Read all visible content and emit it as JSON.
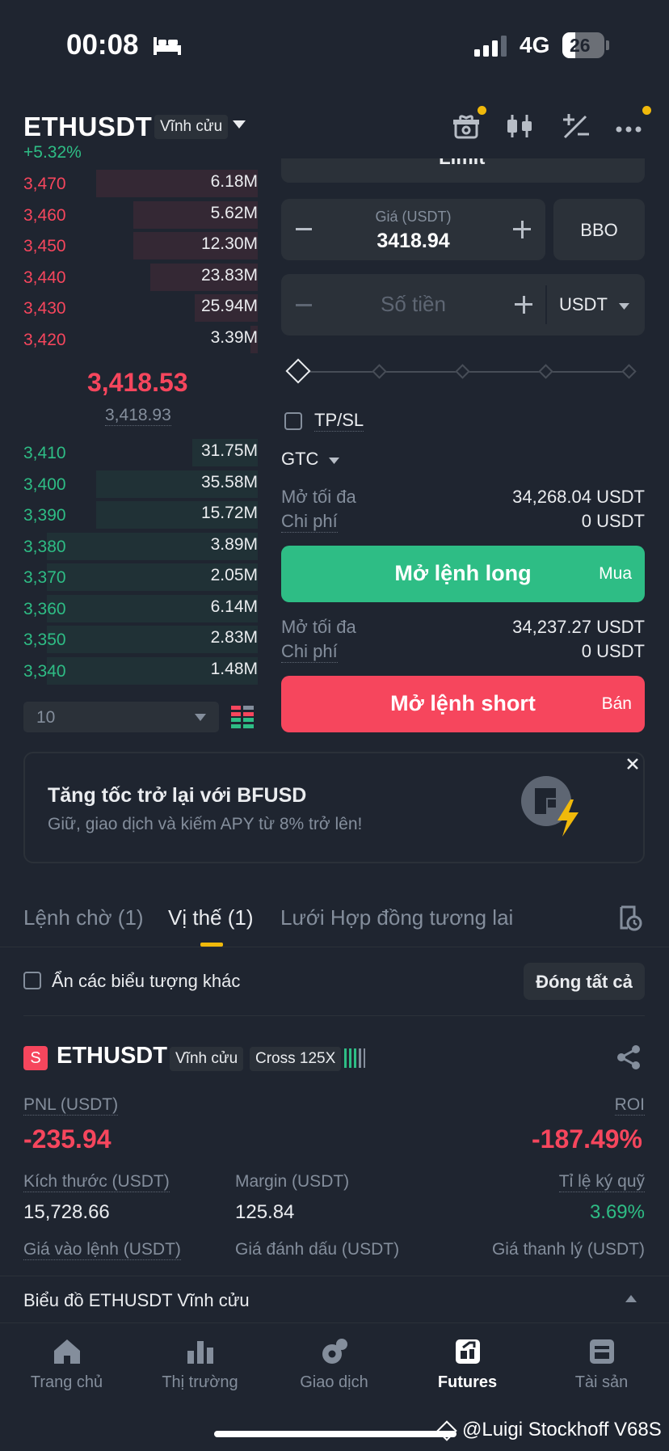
{
  "status_bar": {
    "time": "00:08",
    "network": "4G",
    "battery": "26"
  },
  "header": {
    "pair": "ETHUSDT",
    "contract_type": "Vĩnh cửu",
    "change": "+5.32%"
  },
  "colors": {
    "red": "#f6465d",
    "green": "#2ebd85",
    "accent": "#f0b90b",
    "bg": "#1f2530",
    "panel": "#2b3139"
  },
  "order_book": {
    "asks": [
      {
        "price": "3,470",
        "qty": "6.18M",
        "depth": 0.69
      },
      {
        "price": "3,460",
        "qty": "5.62M",
        "depth": 0.53
      },
      {
        "price": "3,450",
        "qty": "12.30M",
        "depth": 0.53
      },
      {
        "price": "3,440",
        "qty": "23.83M",
        "depth": 0.46
      },
      {
        "price": "3,430",
        "qty": "25.94M",
        "depth": 0.27
      },
      {
        "price": "3,420",
        "qty": "3.39M",
        "depth": 0.03
      }
    ],
    "mid_price": "3,418.53",
    "mark_price": "3,418.93",
    "bids": [
      {
        "price": "3,410",
        "qty": "31.75M",
        "depth": 0.28
      },
      {
        "price": "3,400",
        "qty": "35.58M",
        "depth": 0.69
      },
      {
        "price": "3,390",
        "qty": "15.72M",
        "depth": 0.69
      },
      {
        "price": "3,380",
        "qty": "3.89M",
        "depth": 0.9
      },
      {
        "price": "3,370",
        "qty": "2.05M",
        "depth": 0.9
      },
      {
        "price": "3,360",
        "qty": "6.14M",
        "depth": 0.9
      },
      {
        "price": "3,350",
        "qty": "2.83M",
        "depth": 0.9
      },
      {
        "price": "3,340",
        "qty": "1.48M",
        "depth": 0.9
      }
    ],
    "depth_step": "10"
  },
  "order_form": {
    "order_type": "Limit",
    "price_label": "Giá (USDT)",
    "price_value": "3418.94",
    "bbo_label": "BBO",
    "amount_placeholder": "Số tiền",
    "amount_unit": "USDT",
    "tpsl_label": "TP/SL",
    "tif": "GTC",
    "long": {
      "max_label": "Mở tối đa",
      "max_value": "34,268.04 USDT",
      "cost_label": "Chi phí",
      "cost_value": "0 USDT",
      "button": "Mở lệnh long",
      "side": "Mua"
    },
    "short": {
      "max_label": "Mở tối đa",
      "max_value": "34,237.27 USDT",
      "cost_label": "Chi phí",
      "cost_value": "0 USDT",
      "button": "Mở lệnh short",
      "side": "Bán"
    }
  },
  "banner": {
    "title": "Tăng tốc trở lại với BFUSD",
    "subtitle": "Giữ, giao dịch và kiếm APY từ 8% trở lên!"
  },
  "tabs": [
    {
      "label": "Lệnh chờ (1)"
    },
    {
      "label": "Vị thế (1)"
    },
    {
      "label": "Lưới Hợp đồng tương lai"
    }
  ],
  "positions_toolbar": {
    "hide_label": "Ẩn các biểu tượng khác",
    "close_all": "Đóng tất cả"
  },
  "position": {
    "side_badge": "S",
    "pair": "ETHUSDT",
    "contract_type": "Vĩnh cửu",
    "margin_mode": "Cross 125X",
    "pnl_label": "PNL (USDT)",
    "pnl_value": "-235.94",
    "roi_label": "ROI",
    "roi_value": "-187.49%",
    "size_label": "Kích thước (USDT)",
    "size_value": "15,728.66",
    "margin_label": "Margin (USDT)",
    "margin_value": "125.84",
    "margin_ratio_label": "Tỉ lệ ký quỹ",
    "margin_ratio_value": "3.69%",
    "entry_label": "Giá vào lệnh (USDT)",
    "mark_label": "Giá đánh dấu (USDT)",
    "liq_label": "Giá thanh lý (USDT)"
  },
  "chart_bar": {
    "label": "Biểu đồ ETHUSDT Vĩnh cửu"
  },
  "bottom_nav": [
    {
      "label": "Trang chủ",
      "icon": "home-icon"
    },
    {
      "label": "Thị trường",
      "icon": "market-icon"
    },
    {
      "label": "Giao dịch",
      "icon": "trade-icon"
    },
    {
      "label": "Futures",
      "icon": "futures-icon"
    },
    {
      "label": "Tài sản",
      "icon": "wallet-icon"
    }
  ],
  "watermark": "@Luigi Stockhoff V68S"
}
